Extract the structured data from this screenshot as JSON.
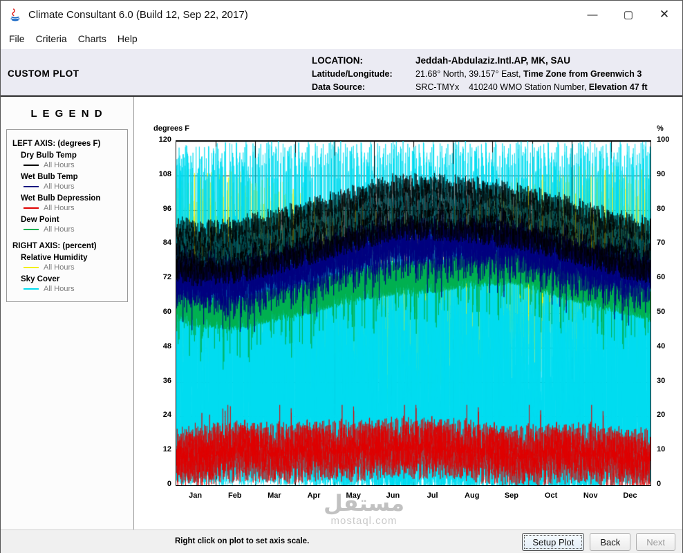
{
  "window": {
    "title": "Climate Consultant 6.0 (Build 12, Sep 22, 2017)",
    "minimize": "—",
    "maximize": "▢",
    "close": "✕"
  },
  "menu": {
    "items": [
      "File",
      "Criteria",
      "Charts",
      "Help"
    ]
  },
  "header": {
    "page_title": "CUSTOM PLOT",
    "location_label": "LOCATION:",
    "location_value": "Jeddah-Abdulaziz.Intl.AP, MK, SAU",
    "latlong_label": "Latitude/Longitude:",
    "latlong_value": "21.68° North, 39.157° East, ",
    "timezone_text": "Time Zone from Greenwich 3",
    "datasource_label": "Data Source:",
    "datasource_value": "SRC-TMYx    410240 WMO Station Number, ",
    "elevation_text": "Elevation 47 ft"
  },
  "legend": {
    "title": "L E G E N D",
    "left_section": "LEFT AXIS: (degrees F)",
    "right_section": "RIGHT AXIS: (percent)",
    "entries": [
      {
        "name": "Dry Bulb Temp",
        "hours": "All Hours"
      },
      {
        "name": "Wet Bulb Temp",
        "hours": "All Hours"
      },
      {
        "name": "Wet Bulb Depression",
        "hours": "All Hours"
      },
      {
        "name": "Dew Point",
        "hours": "All Hours"
      },
      {
        "name": "Relative Humidity",
        "hours": "All Hours"
      },
      {
        "name": "Sky Cover",
        "hours": "All Hours"
      }
    ]
  },
  "chart_data": {
    "type": "line",
    "description": "Hourly annual climate time series for Jeddah (8760 hours); values estimated from plot",
    "x_categories": [
      "Jan",
      "Feb",
      "Mar",
      "Apr",
      "May",
      "Jun",
      "Jul",
      "Aug",
      "Sep",
      "Oct",
      "Nov",
      "Dec"
    ],
    "left_axis": {
      "label": "degrees F",
      "min": 0,
      "max": 120,
      "tick_step": 12
    },
    "right_axis": {
      "label": "%",
      "min": 0,
      "max": 100,
      "tick_step": 10
    },
    "samples_per_year": 8760,
    "draw_order": [
      "rh",
      "sky",
      "dew",
      "wet",
      "dry",
      "dep"
    ],
    "series": [
      {
        "key": "dry",
        "name": "Dry Bulb Temp",
        "axis": "left",
        "color": "#000000",
        "monthly_mean": [
          81,
          82,
          85,
          89,
          93,
          97,
          97,
          96,
          94,
          91,
          87,
          83
        ],
        "diurnal_amp": 8,
        "noise": 4
      },
      {
        "key": "wet",
        "name": "Wet Bulb Temp",
        "axis": "left",
        "color": "#00007f",
        "monthly_mean": [
          71,
          70,
          74,
          77,
          81,
          84,
          84,
          84,
          84,
          80,
          76,
          74
        ],
        "diurnal_amp": 3,
        "noise": 3
      },
      {
        "key": "dep",
        "name": "Wet Bulb Depression",
        "axis": "left",
        "color": "#e00000",
        "monthly_mean": [
          10,
          12,
          11,
          12,
          12,
          13,
          13,
          12,
          10,
          11,
          11,
          9
        ],
        "diurnal_amp": 5,
        "noise": 6
      },
      {
        "key": "dew",
        "name": "Dew Point",
        "axis": "left",
        "color": "#00b050",
        "monthly_mean": [
          61,
          60,
          63,
          66,
          70,
          72,
          73,
          75,
          76,
          72,
          68,
          65
        ],
        "diurnal_amp": 2,
        "noise": 6
      },
      {
        "key": "rh",
        "name": "Relative Humidity",
        "axis": "right",
        "color": "#f2f00c",
        "monthly_mean": [
          62,
          62,
          60,
          56,
          54,
          52,
          50,
          54,
          60,
          63,
          64,
          63
        ],
        "diurnal_amp": 14,
        "noise": 16
      },
      {
        "key": "sky",
        "name": "Sky Cover",
        "axis": "right",
        "color": "#00dcf0",
        "monthly_mean": [
          38,
          42,
          38,
          36,
          32,
          26,
          28,
          32,
          26,
          18,
          30,
          38
        ],
        "diurnal_amp": 0,
        "noise": 38
      }
    ]
  },
  "footer": {
    "hint": "Right click on plot to set axis scale.",
    "setup_button": "Setup Plot",
    "back_button": "Back",
    "next_button": "Next"
  },
  "watermark": {
    "text": "مستقل",
    "subtext": "mostaql.com"
  }
}
